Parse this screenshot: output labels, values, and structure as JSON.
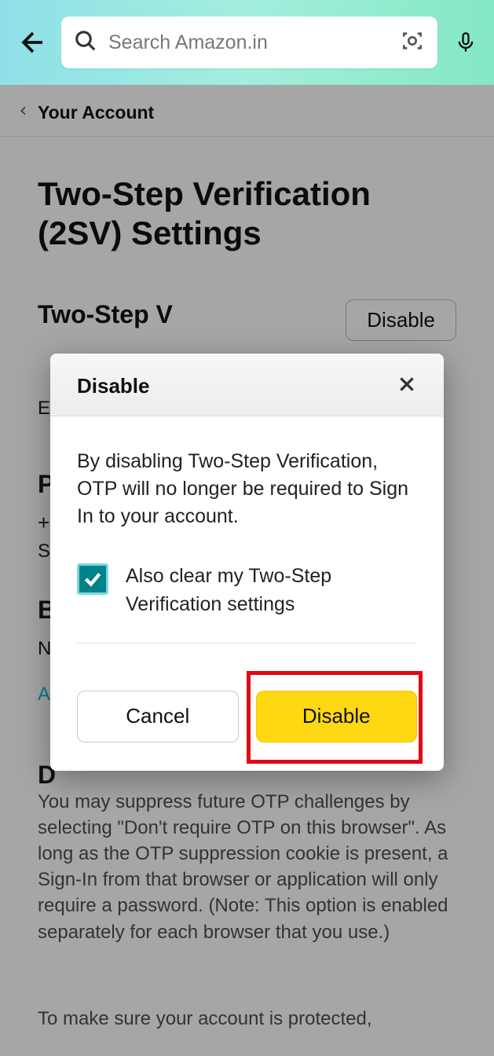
{
  "header": {
    "search_placeholder": "Search Amazon.in"
  },
  "breadcrumb": {
    "label": "Your Account"
  },
  "page": {
    "title": "Two-Step Verification (2SV) Settings",
    "section_heading": "Two-Step V",
    "enabled_fragment": "E",
    "p_fragment": "P",
    "plus_fragment": "+",
    "s_fragment": "S",
    "b_fragment": "B",
    "n_fragment": "N",
    "a_fragment": "A",
    "d_fragment": "D",
    "disable_button": "Disable",
    "otp_paragraph": "You may suppress future OTP challenges by selecting \"Don't require OTP on this browser\". As long as the OTP suppression cookie is present, a Sign-In from that browser or application will only require a password. (Note: This option is enabled separately for each browser that you use.)",
    "protected_line": "To make sure your account is protected,"
  },
  "modal": {
    "title": "Disable",
    "body": "By disabling Two-Step Verification, OTP will no longer be required to Sign In to your account.",
    "checkbox_label": "Also clear my Two-Step Verification settings",
    "cancel": "Cancel",
    "disable": "Disable"
  }
}
